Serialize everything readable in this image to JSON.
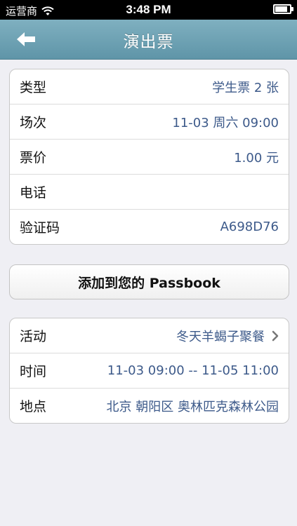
{
  "status": {
    "carrier": "运营商",
    "time": "3:48 PM"
  },
  "nav": {
    "title": "演出票"
  },
  "ticket": {
    "rows": [
      {
        "label": "类型",
        "value": "学生票 2 张"
      },
      {
        "label": "场次",
        "value": "11-03 周六 09:00"
      },
      {
        "label": "票价",
        "value": "1.00 元"
      },
      {
        "label": "电话",
        "value": ""
      },
      {
        "label": "验证码",
        "value": "A698D76"
      }
    ]
  },
  "passbook": {
    "label": "添加到您的 Passbook"
  },
  "event": {
    "rows": [
      {
        "label": "活动",
        "value": "冬天羊蝎子聚餐"
      },
      {
        "label": "时间",
        "value": "11-03 09:00 -- 11-05 11:00"
      },
      {
        "label": "地点",
        "value": "北京 朝阳区 奥林匹克森林公园"
      }
    ]
  },
  "icons": {
    "back": "back-arrow-icon",
    "chevron": "chevron-right-icon",
    "wifi": "wifi-icon",
    "battery": "battery-icon"
  },
  "colors": {
    "nav": "#6fa3b5",
    "value": "#3d5a8a"
  }
}
